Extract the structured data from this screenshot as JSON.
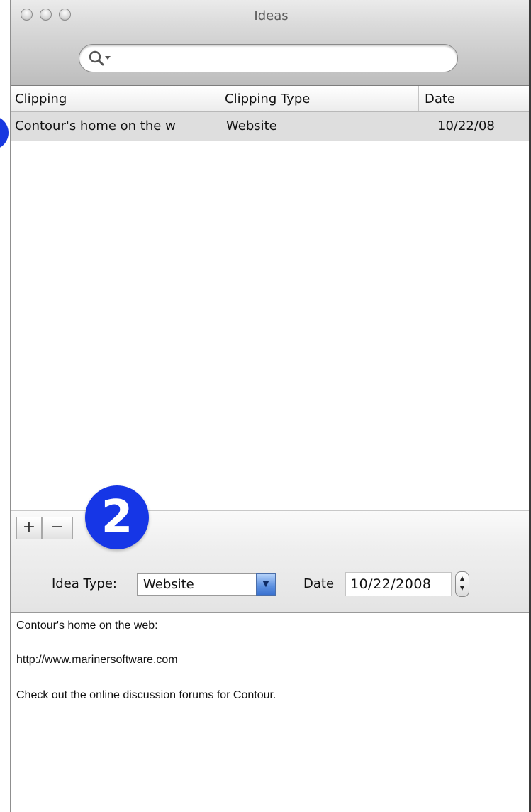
{
  "window": {
    "title": "Ideas"
  },
  "search": {
    "value": "",
    "placeholder": ""
  },
  "table": {
    "columns": [
      "Clipping",
      "Clipping Type",
      "Date"
    ],
    "rows": [
      {
        "clipping": "Contour's home on the w",
        "type": "Website",
        "date": "10/22/08"
      }
    ]
  },
  "toolbar": {
    "add_label": "+",
    "remove_label": "−"
  },
  "callout": {
    "label": "2"
  },
  "detail": {
    "idea_type_label": "Idea Type:",
    "idea_type_value": "Website",
    "date_label": "Date",
    "date_value": "10/22/2008"
  },
  "notes": [
    "Contour's home on the web:",
    "http://www.marinersoftware.com",
    "Check out the online discussion forums for Contour."
  ],
  "colors": {
    "callout_blue": "#1636e6",
    "selected_row": "#dedede",
    "popup_arrow_blue": "#5b8fe0"
  },
  "icons": {
    "search": "magnifier-with-dropdown",
    "window_controls": "traffic-lights-graphite"
  }
}
